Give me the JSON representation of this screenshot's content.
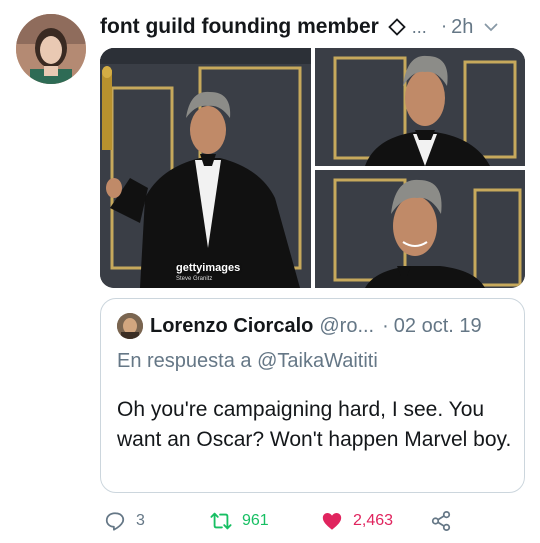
{
  "tweet": {
    "display_name": "font guild founding member",
    "name_ellipsis": "...",
    "separator": "·",
    "time": "2h"
  },
  "media": {
    "watermark": "gettyimages",
    "watermark_credit": "Steve Granitz"
  },
  "quoted": {
    "name": "Lorenzo Ciorcalo",
    "handle": "@ro...",
    "separator": "·",
    "date": "02 oct. 19",
    "reply_prefix": "En respuesta a",
    "reply_mention": "@TaikaWaititi",
    "text": "Oh you're campaigning hard, I see. You want an Oscar? Won't happen Marvel boy."
  },
  "actions": {
    "reply_count": "3",
    "retweet_count": "961",
    "like_count": "2,463"
  },
  "colors": {
    "retweet_green": "#17bf63",
    "like_red": "#e0245e",
    "muted_gray": "#657786"
  },
  "icons": [
    "diamond-icon",
    "chevron-down-icon",
    "reply-icon",
    "retweet-icon",
    "heart-icon",
    "share-icon"
  ]
}
